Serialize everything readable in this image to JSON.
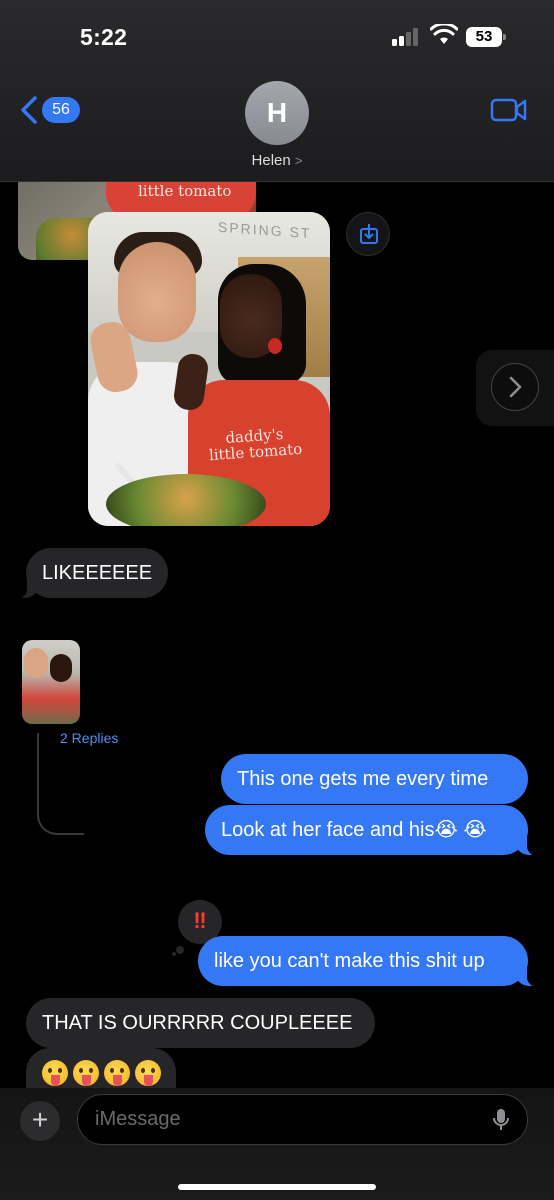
{
  "status_bar": {
    "time": "5:22",
    "battery": "53"
  },
  "header": {
    "back_count": "56",
    "avatar_initial": "H",
    "contact_name": "Helen",
    "name_chevron": ">"
  },
  "photos": {
    "back_shirt_text": "little tomato",
    "main_shirt_text_line1": "daddy's",
    "main_shirt_text_line2": "little tomato",
    "sign_text": "SPRING ST"
  },
  "messages": [
    {
      "text": "LIKEEEEEE"
    },
    {
      "text": "This one gets me every time"
    },
    {
      "text": "Look at her face and his😭 😭"
    },
    {
      "text": "like you can't make this shit up"
    },
    {
      "text": "THAT IS OURRRRR COUPLEEEE"
    }
  ],
  "thread": {
    "replies_label": "2 Replies"
  },
  "reaction": {
    "symbol": "‼"
  },
  "input": {
    "plus": "+",
    "placeholder": "iMessage"
  },
  "colors": {
    "accent": "#3478f6",
    "received_bubble": "#262629",
    "background": "#000000",
    "reaction": "#ff3b30"
  }
}
